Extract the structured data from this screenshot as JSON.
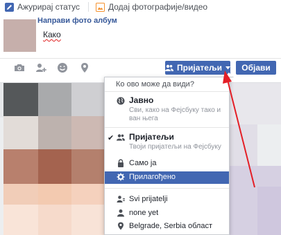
{
  "composer": {
    "tabs": {
      "status_label": "Ажурирај статус",
      "photo_label": "Додај фотографије/видео"
    },
    "album_link": "Направи фото албум",
    "post_text": "Како",
    "audience_button_label": "Пријатељи",
    "post_button_label": "Објави",
    "tool_icons": [
      "camera-icon",
      "tag-friend-icon",
      "feeling-icon",
      "location-icon"
    ]
  },
  "audience_menu": {
    "header": "Ко ово може да види?",
    "options": [
      {
        "label": "Јавно",
        "description": "Сви, како на Фејсбуку тако и ван њега",
        "icon": "globe-icon",
        "checked": false
      },
      {
        "label": "Пријатељи",
        "description": "Твоји пријатељи на Фејсбуку",
        "icon": "friends-icon",
        "checked": true
      },
      {
        "label": "Само ја",
        "icon": "lock-icon",
        "checked": false
      },
      {
        "label": "Прилагођено",
        "icon": "gear-icon",
        "checked": false,
        "highlighted": true
      },
      {
        "label": "Svi prijatelji",
        "icon": "friend-list-icon",
        "checked": false
      },
      {
        "label": "none yet",
        "icon": "user-icon",
        "checked": false
      },
      {
        "label": "Belgrade, Serbia област",
        "icon": "location-pin-icon",
        "checked": false
      }
    ]
  },
  "colors": {
    "accent": "#4267b2",
    "link": "#365899",
    "annotation_arrow": "#e41e26"
  }
}
